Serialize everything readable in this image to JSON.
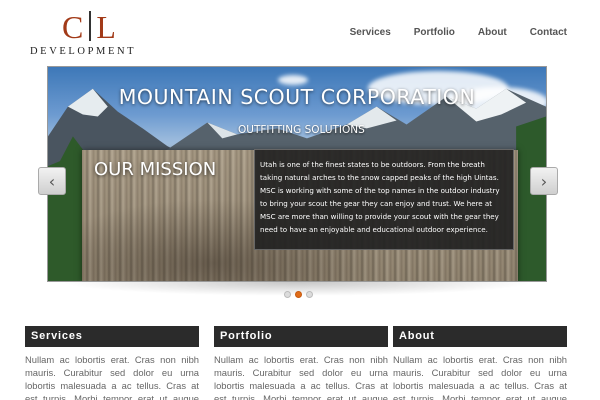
{
  "logo": {
    "mark_left": "C",
    "mark_right": "L",
    "sub": "DEVELOPMENT"
  },
  "nav": {
    "items": [
      "Services",
      "Portfolio",
      "About",
      "Contact"
    ]
  },
  "slider": {
    "title": "MOUNTAIN SCOUT CORPORATION",
    "subtitle": "OUTFITTING SOLUTIONS",
    "mission_title": "OUR MISSION",
    "mission_text": "Utah is one of the finest states to be outdoors. From the breath taking natural arches to the snow capped peaks of the high Uintas. MSC is working with some of the top names in the outdoor industry to bring your scout the gear they can enjoy and trust. We here at MSC are more than willing to provide your scout with the gear they need to have an enjoyable and educational outdoor experience.",
    "prev_arrow": "‹",
    "next_arrow": "›",
    "active_slide": 2,
    "slide_count": 3
  },
  "columns": [
    {
      "heading": "Services",
      "text": "Nullam ac lobortis erat. Cras non nibh mauris. Curabitur sed dolor eu urna lobortis malesuada a ac tellus. Cras at est turpis. Morbi tempor erat ut augue venenatis"
    },
    {
      "heading": "Portfolio",
      "text": "Nullam ac lobortis erat. Cras non nibh mauris. Curabitur sed dolor eu urna lobortis malesuada a ac tellus. Cras at est turpis. Morbi tempor erat ut augue venenatis"
    },
    {
      "heading": "About",
      "text": "Nullam ac lobortis erat. Cras non nibh mauris. Curabitur sed dolor eu urna lobortis malesuada a ac tellus. Cras at est turpis. Morbi tempor erat ut augue venenatis"
    }
  ],
  "colors": {
    "accent": "#e06c18",
    "brand": "#a23a18",
    "header_bar": "#2b2b2b"
  }
}
